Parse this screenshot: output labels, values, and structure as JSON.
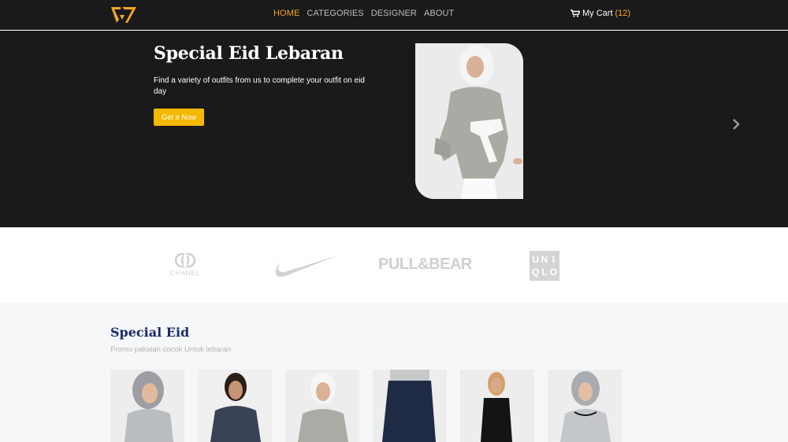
{
  "navbar": {
    "logo_icon": "brand-logo-icon",
    "links": [
      {
        "label": "HOME",
        "active": true
      },
      {
        "label": "CATEGORIES",
        "active": false
      },
      {
        "label": "DESIGNER",
        "active": false
      },
      {
        "label": "ABOUT",
        "active": false
      }
    ],
    "cart": {
      "icon": "cart-icon",
      "label": "My Cart",
      "count": "(12)"
    }
  },
  "hero": {
    "title": "Special Eid Lebaran",
    "description": "Find a variety of outfits from us to complete your outfit on eid day",
    "button_label": "Get it Now",
    "next_icon": "chevron-right-icon"
  },
  "brands": {
    "chanel": "CHANEL",
    "pull_bear": "PULL&BEAR",
    "uniqlo": [
      "U",
      "N",
      "I",
      "Q",
      "L",
      "O"
    ]
  },
  "section": {
    "title": "Special Eid",
    "subtitle": "Promo pakaian cocok Untuk lebaran"
  },
  "colors": {
    "accent": "#f5a623",
    "button": "#f5b800",
    "dark_bg": "#1a1a1a",
    "section_title": "#1b2a6b"
  }
}
